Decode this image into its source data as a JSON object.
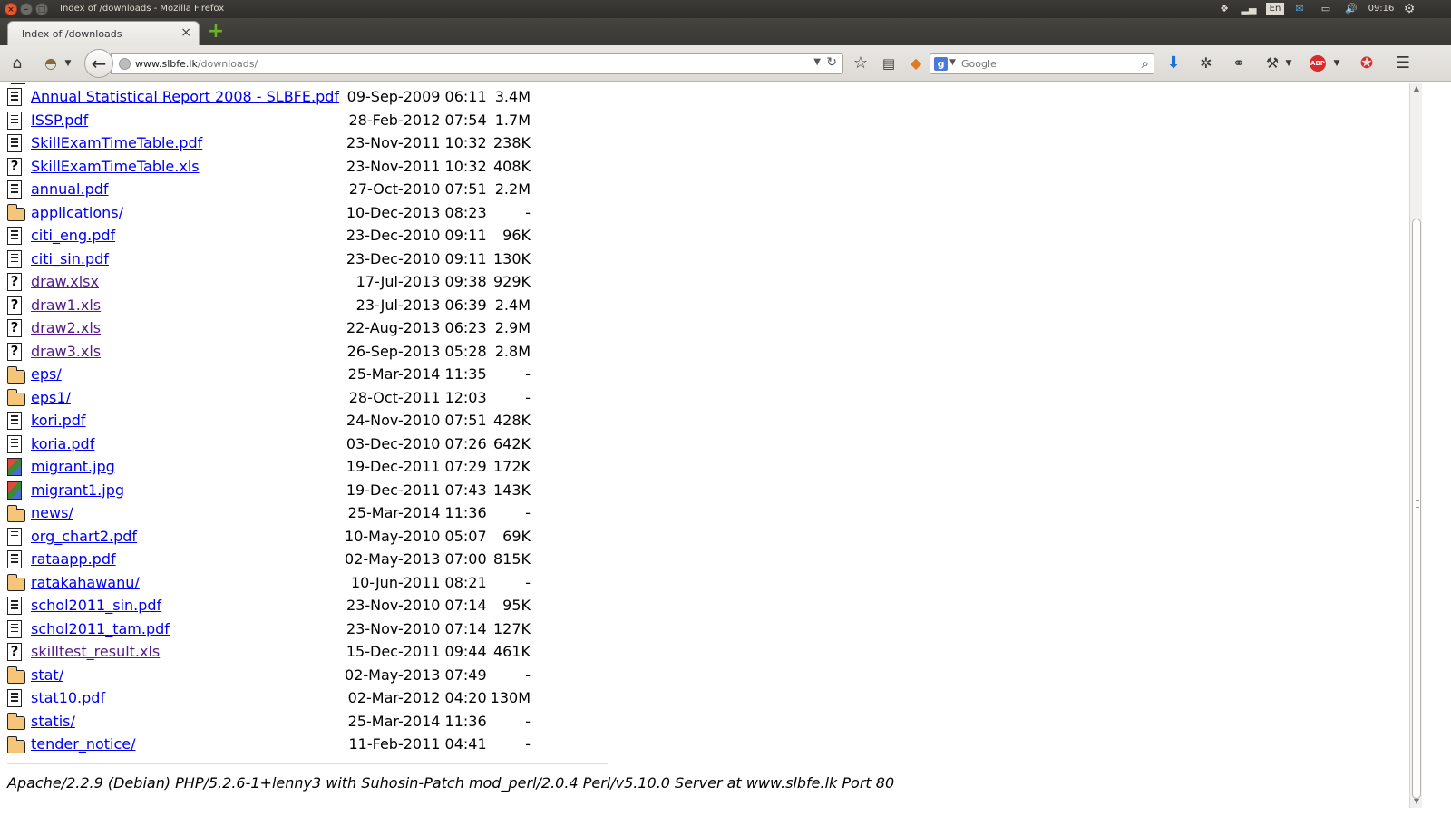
{
  "window": {
    "title": "Index of /downloads - Mozilla Firefox",
    "tray": {
      "keyboard": "En",
      "clock": "09:16"
    }
  },
  "tab": {
    "title": "Index of /downloads",
    "close": "×",
    "new_tab": "+"
  },
  "toolbar": {
    "back": "←",
    "url_domain": "www.slbfe.lk",
    "url_path": "/downloads/",
    "search_engine": "g",
    "search_placeholder": "Google"
  },
  "listing": {
    "rows": [
      {
        "icon": "file",
        "name": "Annual Statistical Report 2008 - SLBFE.pdf",
        "date": "09-Sep-2009 06:11",
        "size": "3.4M",
        "visited": false
      },
      {
        "icon": "file",
        "name": "ISSP.pdf",
        "date": "28-Feb-2012 07:54",
        "size": "1.7M",
        "visited": false
      },
      {
        "icon": "file",
        "name": "SkillExamTimeTable.pdf",
        "date": "23-Nov-2011 10:32",
        "size": "238K",
        "visited": false
      },
      {
        "icon": "unknown",
        "name": "SkillExamTimeTable.xls",
        "date": "23-Nov-2011 10:32",
        "size": "408K",
        "visited": false
      },
      {
        "icon": "file",
        "name": "annual.pdf",
        "date": "27-Oct-2010 07:51",
        "size": "2.2M",
        "visited": false
      },
      {
        "icon": "folder",
        "name": "applications/",
        "date": "10-Dec-2013 08:23",
        "size": "-",
        "visited": false
      },
      {
        "icon": "file",
        "name": "citi_eng.pdf",
        "date": "23-Dec-2010 09:11",
        "size": "96K",
        "visited": false
      },
      {
        "icon": "file",
        "name": "citi_sin.pdf",
        "date": "23-Dec-2010 09:11",
        "size": "130K",
        "visited": false
      },
      {
        "icon": "unknown",
        "name": "draw.xlsx",
        "date": "17-Jul-2013 09:38",
        "size": "929K",
        "visited": true
      },
      {
        "icon": "unknown",
        "name": "draw1.xls",
        "date": "23-Jul-2013 06:39",
        "size": "2.4M",
        "visited": true
      },
      {
        "icon": "unknown",
        "name": "draw2.xls",
        "date": "22-Aug-2013 06:23",
        "size": "2.9M",
        "visited": true
      },
      {
        "icon": "unknown",
        "name": "draw3.xls",
        "date": "26-Sep-2013 05:28",
        "size": "2.8M",
        "visited": true
      },
      {
        "icon": "folder",
        "name": "eps/",
        "date": "25-Mar-2014 11:35",
        "size": "-",
        "visited": false
      },
      {
        "icon": "folder",
        "name": "eps1/",
        "date": "28-Oct-2011 12:03",
        "size": "-",
        "visited": false
      },
      {
        "icon": "file",
        "name": "kori.pdf",
        "date": "24-Nov-2010 07:51",
        "size": "428K",
        "visited": false
      },
      {
        "icon": "file",
        "name": "koria.pdf",
        "date": "03-Dec-2010 07:26",
        "size": "642K",
        "visited": false
      },
      {
        "icon": "image",
        "name": "migrant.jpg",
        "date": "19-Dec-2011 07:29",
        "size": "172K",
        "visited": false
      },
      {
        "icon": "image",
        "name": "migrant1.jpg",
        "date": "19-Dec-2011 07:43",
        "size": "143K",
        "visited": false
      },
      {
        "icon": "folder",
        "name": "news/",
        "date": "25-Mar-2014 11:36",
        "size": "-",
        "visited": false
      },
      {
        "icon": "file",
        "name": "org_chart2.pdf",
        "date": "10-May-2010 05:07",
        "size": "69K",
        "visited": false
      },
      {
        "icon": "file",
        "name": "rataapp.pdf",
        "date": "02-May-2013 07:00",
        "size": "815K",
        "visited": false
      },
      {
        "icon": "folder",
        "name": "ratakahawanu/",
        "date": "10-Jun-2011 08:21",
        "size": "-",
        "visited": false
      },
      {
        "icon": "file",
        "name": "schol2011_sin.pdf",
        "date": "23-Nov-2010 07:14",
        "size": "95K",
        "visited": false
      },
      {
        "icon": "file",
        "name": "schol2011_tam.pdf",
        "date": "23-Nov-2010 07:14",
        "size": "127K",
        "visited": false
      },
      {
        "icon": "unknown",
        "name": "skilltest_result.xls",
        "date": "15-Dec-2011 09:44",
        "size": "461K",
        "visited": true
      },
      {
        "icon": "folder",
        "name": "stat/",
        "date": "02-May-2013 07:49",
        "size": "-",
        "visited": false
      },
      {
        "icon": "file",
        "name": "stat10.pdf",
        "date": "02-Mar-2012 04:20",
        "size": "130M",
        "visited": false
      },
      {
        "icon": "folder",
        "name": "statis/",
        "date": "25-Mar-2014 11:36",
        "size": "-",
        "visited": false
      },
      {
        "icon": "folder",
        "name": "tender_notice/",
        "date": "11-Feb-2011 04:41",
        "size": "-",
        "visited": false
      }
    ]
  },
  "footer": {
    "server_signature": "Apache/2.2.9 (Debian) PHP/5.2.6-1+lenny3 with Suhosin-Patch mod_perl/2.0.4 Perl/v5.10.0 Server at www.slbfe.lk Port 80"
  },
  "colors": {
    "link": "#0000ee",
    "visited_link": "#551a8b",
    "titlebar": "#3c3b37",
    "close_button": "#e95a2f",
    "new_tab_plus": "#6bb22a"
  }
}
